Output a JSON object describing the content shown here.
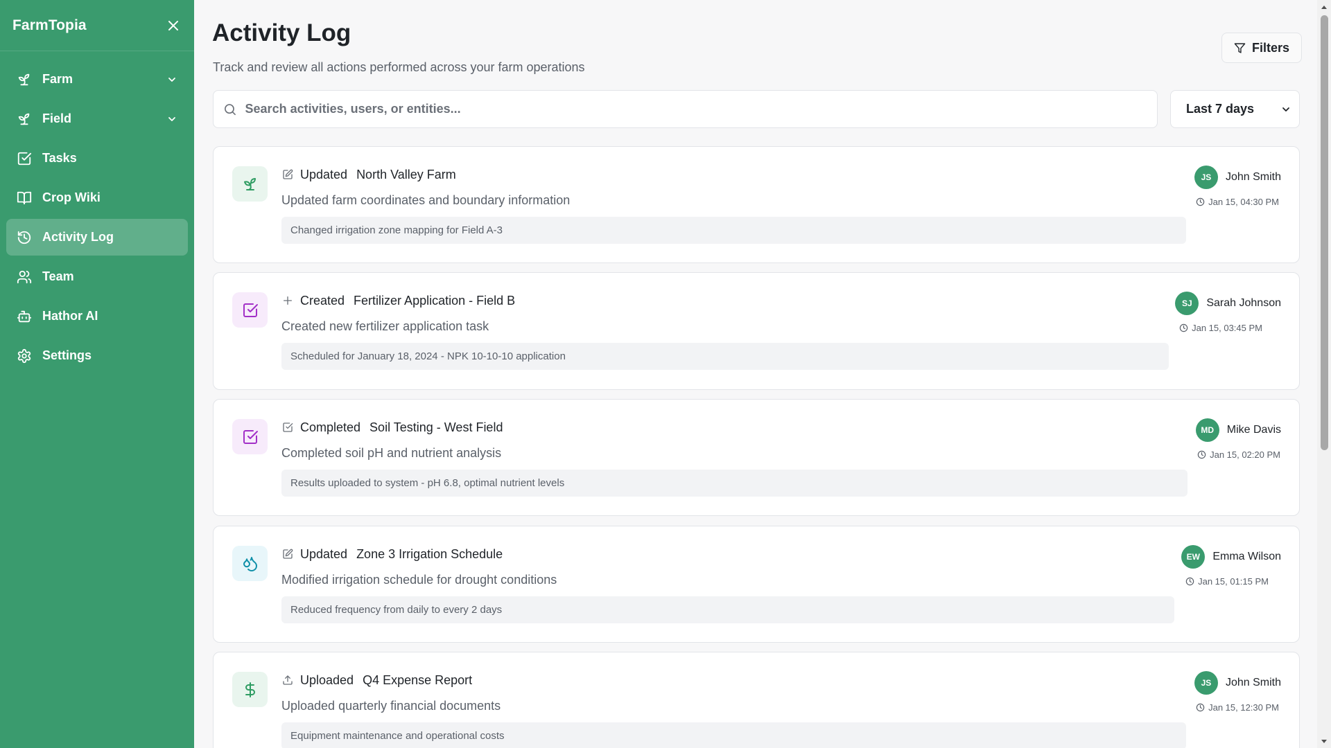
{
  "app": {
    "name": "FarmTopia"
  },
  "sidebar": {
    "items": [
      {
        "label": "Farm",
        "icon": "sprout-icon",
        "has_chevron": true,
        "active": false
      },
      {
        "label": "Field",
        "icon": "sprout-icon",
        "has_chevron": true,
        "active": false
      },
      {
        "label": "Tasks",
        "icon": "check-square-icon",
        "has_chevron": false,
        "active": false
      },
      {
        "label": "Crop Wiki",
        "icon": "book-open-icon",
        "has_chevron": false,
        "active": false
      },
      {
        "label": "Activity Log",
        "icon": "history-icon",
        "has_chevron": false,
        "active": true
      },
      {
        "label": "Team",
        "icon": "users-icon",
        "has_chevron": false,
        "active": false
      },
      {
        "label": "Hathor AI",
        "icon": "bot-icon",
        "has_chevron": false,
        "active": false
      },
      {
        "label": "Settings",
        "icon": "gear-icon",
        "has_chevron": false,
        "active": false
      }
    ]
  },
  "header": {
    "title": "Activity Log",
    "subtitle": "Track and review all actions performed across your farm operations",
    "filters_label": "Filters"
  },
  "search": {
    "placeholder": "Search activities, users, or entities..."
  },
  "date_range": {
    "selected": "Last 7 days"
  },
  "activities": [
    {
      "action": "Updated",
      "action_icon": "edit-icon",
      "entity": "North Valley Farm",
      "type_icon": "sprout-icon",
      "description": "Updated farm coordinates and boundary information",
      "detail": "Changed irrigation zone mapping for Field A-3",
      "user_initials": "JS",
      "user": "John Smith",
      "time": "Jan 15, 04:30 PM"
    },
    {
      "action": "Created",
      "action_icon": "plus-icon",
      "entity": "Fertilizer Application - Field B",
      "type_icon": "check-square-icon",
      "description": "Created new fertilizer application task",
      "detail": "Scheduled for January 18, 2024 - NPK 10-10-10 application",
      "user_initials": "SJ",
      "user": "Sarah Johnson",
      "time": "Jan 15, 03:45 PM"
    },
    {
      "action": "Completed",
      "action_icon": "check-square-icon",
      "entity": "Soil Testing - West Field",
      "type_icon": "check-square-icon",
      "description": "Completed soil pH and nutrient analysis",
      "detail": "Results uploaded to system - pH 6.8, optimal nutrient levels",
      "user_initials": "MD",
      "user": "Mike Davis",
      "time": "Jan 15, 02:20 PM"
    },
    {
      "action": "Updated",
      "action_icon": "edit-icon",
      "entity": "Zone 3 Irrigation Schedule",
      "type_icon": "droplets-icon",
      "description": "Modified irrigation schedule for drought conditions",
      "detail": "Reduced frequency from daily to every 2 days",
      "user_initials": "EW",
      "user": "Emma Wilson",
      "time": "Jan 15, 01:15 PM"
    },
    {
      "action": "Uploaded",
      "action_icon": "upload-icon",
      "entity": "Q4 Expense Report",
      "type_icon": "dollar-icon",
      "description": "Uploaded quarterly financial documents",
      "detail": "Equipment maintenance and operational costs",
      "user_initials": "JS",
      "user": "John Smith",
      "time": "Jan 15, 12:30 PM"
    }
  ],
  "colors": {
    "sidebar_bg": "#3a9b6e",
    "avatar_bg": "#3a9b6e",
    "green_icon": "#2e9c62",
    "purple_icon": "#a22fc7",
    "cyan_icon": "#0e8fa8"
  }
}
